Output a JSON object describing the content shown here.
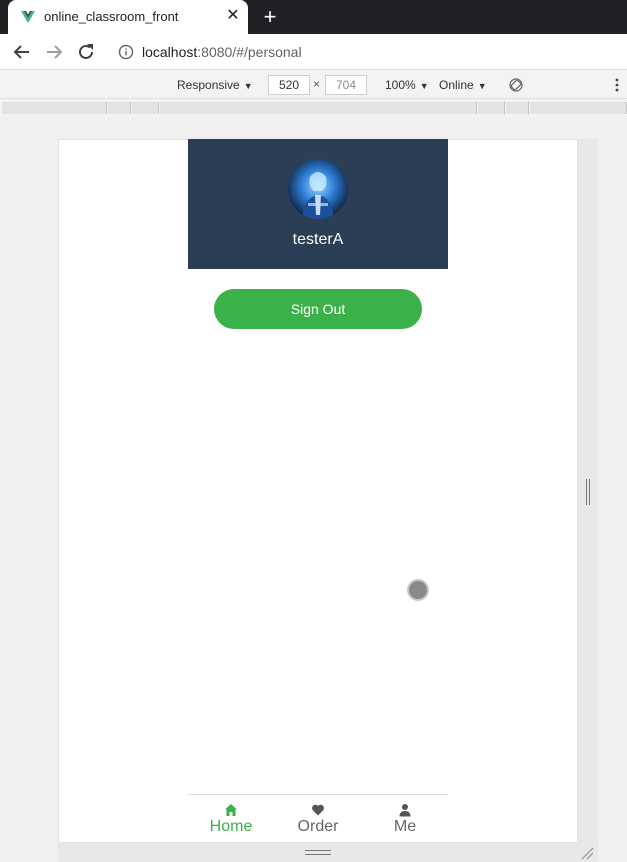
{
  "browser": {
    "tab_title": "online_classroom_front",
    "url_host": "localhost",
    "url_rest": ":8080/#/personal"
  },
  "device_toolbar": {
    "mode": "Responsive",
    "width": "520",
    "height": "704",
    "zoom": "100%",
    "network": "Online"
  },
  "profile": {
    "username": "testerA"
  },
  "actions": {
    "sign_out_label": "Sign Out"
  },
  "tabbar": {
    "items": [
      {
        "label": "Home",
        "icon": "home-icon",
        "active": true
      },
      {
        "label": "Order",
        "icon": "heart-icon",
        "active": false
      },
      {
        "label": "Me",
        "icon": "user-icon",
        "active": false
      }
    ]
  },
  "colors": {
    "accent": "#3bb14a",
    "header_bg": "#2c3e55"
  }
}
